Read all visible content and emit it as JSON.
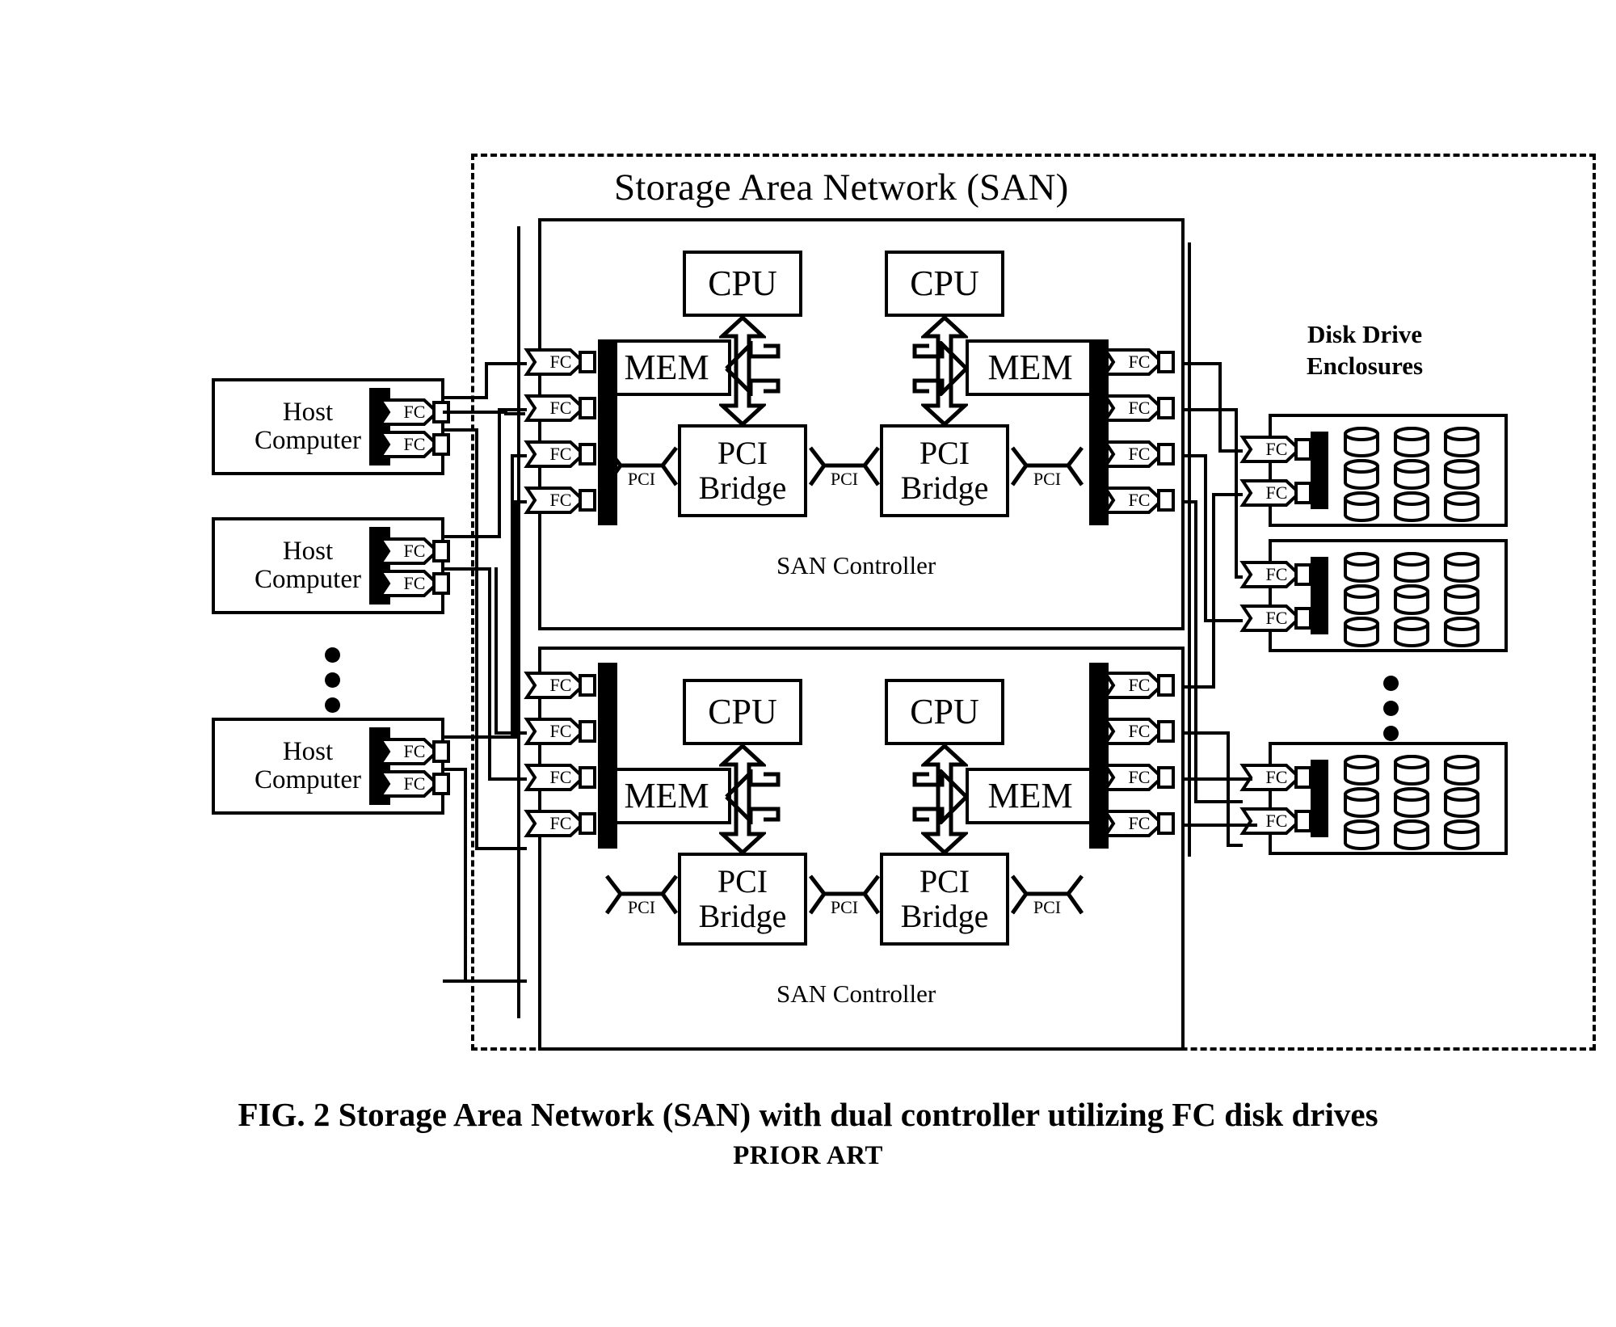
{
  "figure": {
    "caption_line1": "FIG. 2 Storage Area Network (SAN) with dual controller utilizing FC disk drives",
    "caption_line2": "PRIOR ART"
  },
  "san": {
    "title": "Storage Area Network (SAN)",
    "controller_label": "SAN Controller",
    "controllers": [
      {
        "label": "SAN Controller",
        "cpus": [
          "CPU",
          "CPU"
        ],
        "mems": [
          "MEM",
          "MEM"
        ],
        "bridges": [
          "PCI Bridge",
          "PCI Bridge"
        ],
        "pci_links": [
          "PCI",
          "PCI",
          "PCI"
        ],
        "left_ports": [
          "FC",
          "FC",
          "FC",
          "FC"
        ],
        "right_ports": [
          "FC",
          "FC",
          "FC",
          "FC"
        ]
      },
      {
        "label": "SAN Controller",
        "cpus": [
          "CPU",
          "CPU"
        ],
        "mems": [
          "MEM",
          "MEM"
        ],
        "bridges": [
          "PCI Bridge",
          "PCI Bridge"
        ],
        "pci_links": [
          "PCI",
          "PCI",
          "PCI"
        ],
        "left_ports": [
          "FC",
          "FC",
          "FC",
          "FC"
        ],
        "right_ports": [
          "FC",
          "FC",
          "FC",
          "FC"
        ]
      }
    ]
  },
  "hosts": {
    "label_line1": "Host",
    "label_line2": "Computer",
    "items": [
      {
        "name": "Host Computer",
        "ports": [
          "FC",
          "FC"
        ]
      },
      {
        "name": "Host Computer",
        "ports": [
          "FC",
          "FC"
        ]
      },
      {
        "name": "Host Computer",
        "ports": [
          "FC",
          "FC"
        ]
      }
    ],
    "ellipsis": "⋮"
  },
  "enclosures": {
    "title_line1": "Disk Drive",
    "title_line2": "Enclosures",
    "items": [
      {
        "ports": [
          "FC",
          "FC"
        ],
        "drive_rows": 3,
        "drive_cols": 3
      },
      {
        "ports": [
          "FC",
          "FC"
        ],
        "drive_rows": 3,
        "drive_cols": 3
      },
      {
        "ports": [
          "FC",
          "FC"
        ],
        "drive_rows": 3,
        "drive_cols": 3
      }
    ],
    "ellipsis": "⋮"
  },
  "labels": {
    "cpu": "CPU",
    "mem": "MEM",
    "pci_bridge_line1": "PCI",
    "pci_bridge_line2": "Bridge",
    "pci": "PCI",
    "fc": "FC"
  },
  "colors": {
    "ink": "#000000",
    "paper": "#ffffff"
  }
}
